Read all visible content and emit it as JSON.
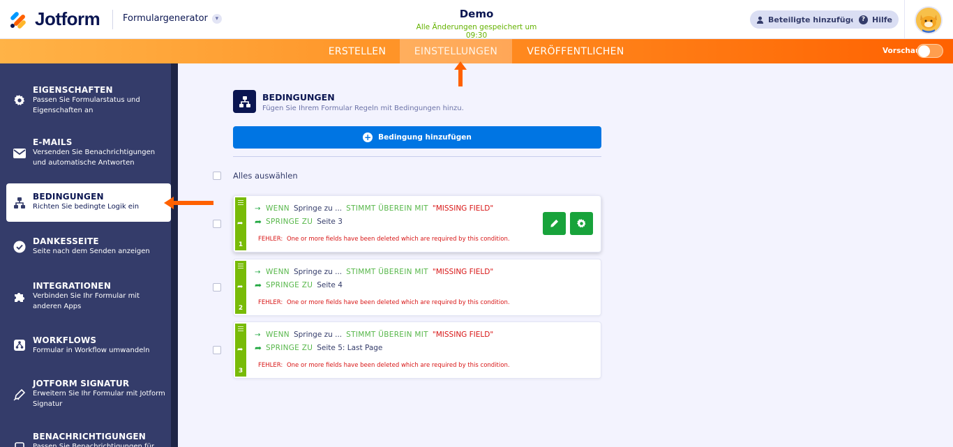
{
  "header": {
    "brand": "Jotform",
    "form_generator": "Formulargenerator",
    "form_title": "Demo",
    "save_status": "Alle Änderungen gespeichert um 09:30",
    "add_participants": "Beteiligte hinzufügen",
    "help": "Hilfe"
  },
  "nav": {
    "tabs": [
      {
        "label": "ERSTELLEN"
      },
      {
        "label": "EINSTELLUNGEN",
        "active": true
      },
      {
        "label": "VERÖFFENTLICHEN"
      }
    ],
    "preview_label": "Vorschau",
    "preview_on": false
  },
  "sidebar": {
    "items": [
      {
        "title": "EIGENSCHAFTEN",
        "desc": "Passen Sie Formularstatus und Eigenschaften an",
        "icon": "gear-icon"
      },
      {
        "title": "E-MAILS",
        "desc": "Versenden Sie Benachrichtigungen und automatische Antworten",
        "icon": "envelope-icon"
      },
      {
        "title": "BEDINGUNGEN",
        "desc": "Richten Sie bedingte Logik ein",
        "icon": "hierarchy-icon",
        "active": true
      },
      {
        "title": "DANKESSEITE",
        "desc": "Seite nach dem Senden anzeigen",
        "icon": "check-circle-icon"
      },
      {
        "title": "INTEGRATIONEN",
        "desc": "Verbinden Sie Ihr Formular mit anderen Apps",
        "icon": "puzzle-icon"
      },
      {
        "title": "WORKFLOWS",
        "desc": "Formular in Workflow umwandeln",
        "icon": "workflow-icon"
      },
      {
        "title": "JOTFORM SIGNATUR",
        "desc": "Erweitern Sie Ihr Formular mit Jotform Signatur",
        "icon": "pen-icon"
      },
      {
        "title": "BENACHRICHTIGUNGEN",
        "desc": "Passen Sie Benachrichtigungen für",
        "icon": "bell-icon"
      }
    ]
  },
  "main": {
    "title": "BEDINGUNGEN",
    "subtitle": "Fügen Sie Ihrem Formular Regeln mit Bedingungen hinzu.",
    "add_button": "Bedingung hinzufügen",
    "select_all": "Alles auswählen",
    "conditions": [
      {
        "num": "1",
        "if_kw": "WENN",
        "if_val": "Springe zu ...",
        "match_kw": "STIMMT ÜBEREIN MIT",
        "match_val": "\"MISSING FIELD\"",
        "then_kw": "SPRINGE ZU",
        "then_val": "Seite 3",
        "error_label": "FEHLER:",
        "error_text": "One or more fields have been deleted which are required by this condition."
      },
      {
        "num": "2",
        "if_kw": "WENN",
        "if_val": "Springe zu ...",
        "match_kw": "STIMMT ÜBEREIN MIT",
        "match_val": "\"MISSING FIELD\"",
        "then_kw": "SPRINGE ZU",
        "then_val": "Seite 4",
        "error_label": "FEHLER:",
        "error_text": "One or more fields have been deleted which are required by this condition."
      },
      {
        "num": "3",
        "if_kw": "WENN",
        "if_val": "Springe zu ...",
        "match_kw": "STIMMT ÜBEREIN MIT",
        "match_val": "\"MISSING FIELD\"",
        "then_kw": "SPRINGE ZU",
        "then_val": "Seite 5: Last Page",
        "error_label": "FEHLER:",
        "error_text": "One or more fields have been deleted which are required by this condition."
      }
    ]
  },
  "colors": {
    "accent_orange": "#ff6100",
    "sidebar": "#343c6a",
    "primary_blue": "#0075e3",
    "action_green": "#18a33b",
    "error_red": "#d81515"
  }
}
